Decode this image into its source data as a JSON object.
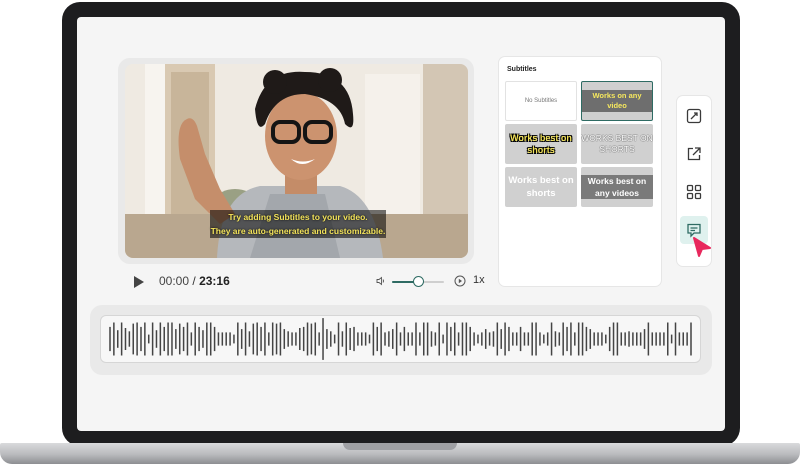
{
  "video": {
    "caption_line1": "Try adding Subtitles to your video.",
    "caption_line2": "They are auto-generated and customizable."
  },
  "player": {
    "current_time": "00:00",
    "separator": "/",
    "total_time": "23:16",
    "volume_level": 0.5,
    "speed": "1x",
    "icons": [
      "play-icon",
      "volume-icon",
      "speed-icon"
    ]
  },
  "subtitles_panel": {
    "title": "Subtitles",
    "options": [
      {
        "label": "No Subtitles"
      },
      {
        "label": "Works on any video",
        "selected": true
      },
      {
        "label": "Works best on shorts"
      },
      {
        "label": "WORKS BEST ON SHORTS"
      },
      {
        "label": "Works best on shorts"
      },
      {
        "label": "Works best on any videos"
      }
    ]
  },
  "toolbar": {
    "items": [
      {
        "icon": "resize-icon"
      },
      {
        "icon": "share-icon"
      },
      {
        "icon": "grid-icon"
      },
      {
        "icon": "subtitles-icon",
        "active": true
      }
    ]
  },
  "waveform": {
    "levels": [
      0.55,
      0.75,
      0.4,
      0.75,
      0.5,
      0.35,
      0.7,
      0.75,
      0.55,
      0.75,
      0.2,
      0.75,
      0.4,
      0.75,
      0.55,
      0.75,
      0.75,
      0.45,
      0.7,
      0.55,
      0.75,
      0.3,
      0.75,
      0.55,
      0.4,
      0.75,
      0.75,
      0.55,
      0.3,
      0.3,
      0.3,
      0.3,
      0.2,
      0.75,
      0.45,
      0.75,
      0.35,
      0.7,
      0.75,
      0.55,
      0.75,
      0.3,
      0.75,
      0.7,
      0.75,
      0.45,
      0.35,
      0.3,
      0.3,
      0.5,
      0.55,
      0.75,
      0.7,
      0.75,
      0.3,
      0.95,
      0.45,
      0.35,
      0.2,
      0.75,
      0.35,
      0.75,
      0.5,
      0.55,
      0.3,
      0.3,
      0.3,
      0.2,
      0.75,
      0.55,
      0.75,
      0.3,
      0.35,
      0.45,
      0.75,
      0.3,
      0.55,
      0.3,
      0.3,
      0.75,
      0.3,
      0.75,
      0.75,
      0.35,
      0.3,
      0.75,
      0.2,
      0.75,
      0.55,
      0.75,
      0.3,
      0.75,
      0.75,
      0.55,
      0.3,
      0.2,
      0.3,
      0.45,
      0.3,
      0.35,
      0.75,
      0.45,
      0.75,
      0.55,
      0.3,
      0.3,
      0.55,
      0.3,
      0.3,
      0.75,
      0.75,
      0.3,
      0.2,
      0.3,
      0.75,
      0.35,
      0.3,
      0.75,
      0.55,
      0.75,
      0.3,
      0.75,
      0.75,
      0.55,
      0.45,
      0.3,
      0.3,
      0.3,
      0.2,
      0.55,
      0.75,
      0.75,
      0.3,
      0.3,
      0.35,
      0.3,
      0.3,
      0.3,
      0.45,
      0.75,
      0.3,
      0.3,
      0.3,
      0.3,
      0.75,
      0.2,
      0.75,
      0.3,
      0.3,
      0.3,
      0.75
    ],
    "accent_color": "#444444"
  },
  "colors": {
    "accent": "#2e6b63",
    "pointer": "#e8285d",
    "caption": "#f3e35a"
  }
}
